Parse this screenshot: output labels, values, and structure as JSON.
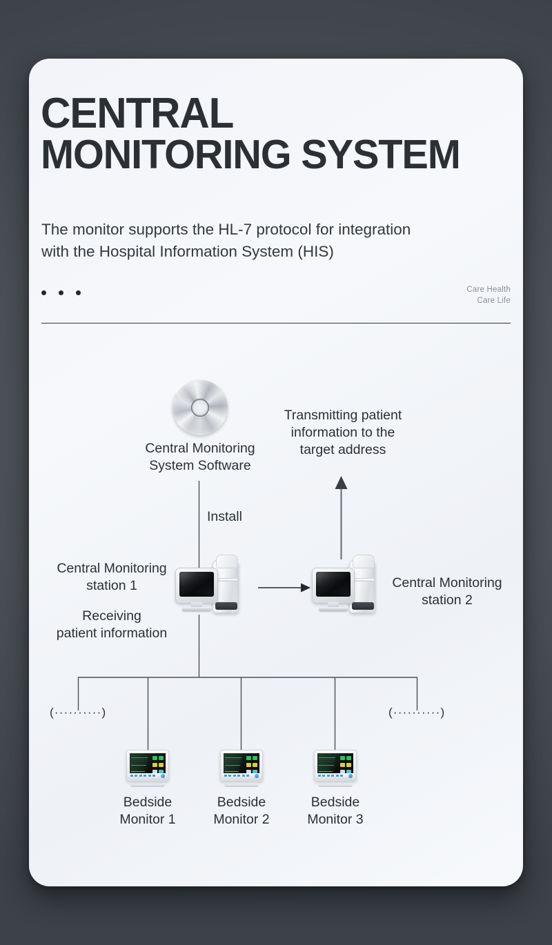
{
  "header": {
    "title_line1": "CENTRAL",
    "title_line2": "MONITORING SYSTEM",
    "subtitle_line1": "The monitor supports the HL-7 protocol for integration",
    "subtitle_line2": "with the Hospital Information System (HIS)",
    "tagline_line1": "Care Health",
    "tagline_line2": "Care Life"
  },
  "diagram": {
    "software_label": "Central Monitoring\nSystem Software",
    "transmit_label": "Transmitting patient\ninformation to the\ntarget address",
    "install_label": "Install",
    "station1_label": "Central Monitoring\nstation 1",
    "station1_sub": "Receiving\npatient information",
    "station2_label": "Central Monitoring\nstation  2",
    "ellipsis_left": "(··········)",
    "ellipsis_right": "(··········)",
    "bedside": [
      {
        "label": "Bedside\nMonitor 1"
      },
      {
        "label": "Bedside\nMonitor 2"
      },
      {
        "label": "Bedside\nMonitor 3"
      }
    ]
  },
  "colors": {
    "page_background": "#4a4f55",
    "card_background": "#f4f6fa",
    "title_text": "#2c3034",
    "body_text": "#2b3035",
    "tagline_text": "#8b9098",
    "rule": "#2f3338",
    "connector_line": "#4c5156",
    "monitor_accent_blue": "#3b9ede",
    "monitor_waveform_green": "#4fc47a"
  }
}
